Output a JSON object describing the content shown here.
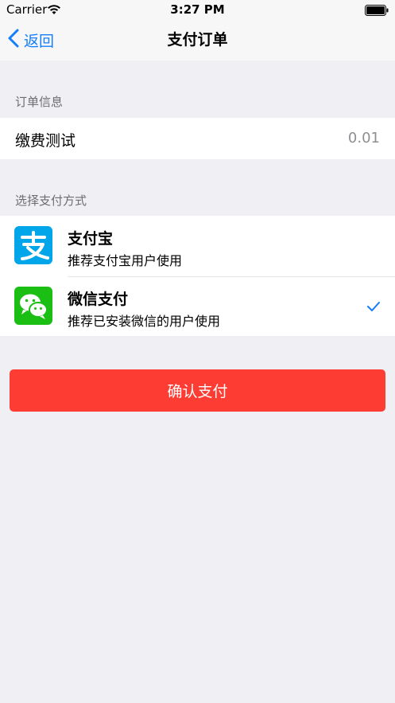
{
  "status_bar": {
    "carrier": "Carrier",
    "time": "3:27 PM"
  },
  "nav": {
    "back_label": "返回",
    "title": "支付订单"
  },
  "order_section": {
    "header": "订单信息",
    "item_name": "缴费测试",
    "amount": "0.01"
  },
  "payment_section": {
    "header": "选择支付方式",
    "methods": [
      {
        "title": "支付宝",
        "desc": "推荐支付宝用户使用",
        "selected": false,
        "icon": "alipay-logo",
        "color": "#00a6e9"
      },
      {
        "title": "微信支付",
        "desc": "推荐已安装微信的用户使用",
        "selected": true,
        "icon": "wechat-logo",
        "color": "#1bbf14"
      }
    ]
  },
  "confirm_button": {
    "label": "确认支付",
    "color": "#fd3d33"
  },
  "colors": {
    "accent": "#157efb",
    "background": "#efeff4"
  }
}
